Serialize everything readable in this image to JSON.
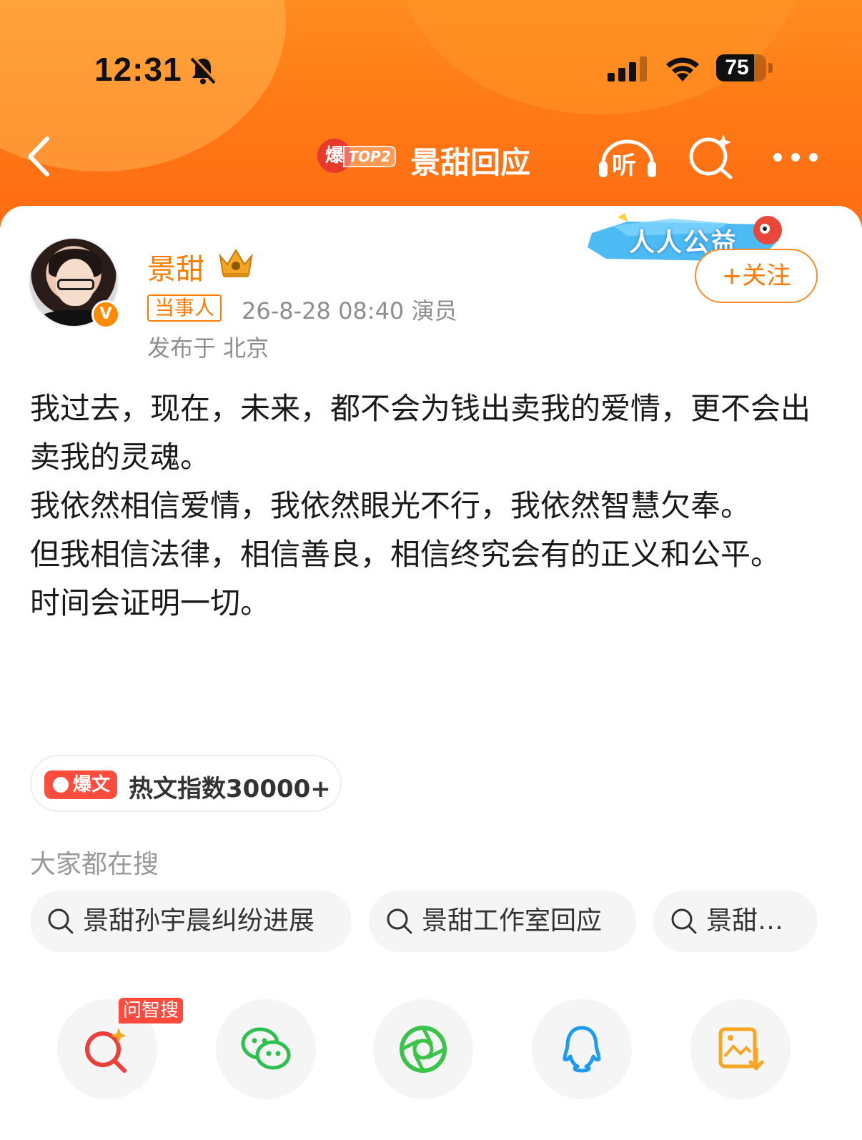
{
  "status_bar": {
    "time": "12:31",
    "battery": "75",
    "battery_level": 0.75
  },
  "nav": {
    "hot_badge_char": "爆",
    "rank": "TOP2",
    "title": "景甜回应",
    "listen_label": "听"
  },
  "post": {
    "author": "景甜",
    "role_tag": "当事人",
    "meta": "26-8-28 08:40  演员",
    "location": "发布于 北京",
    "follow_label": "+关注",
    "charity_banner": "人人公益",
    "verified_mark": "V",
    "body": [
      "我过去，现在，未来，都不会为钱出卖我的爱情，更不会出卖我的灵魂。",
      "我依然相信爱情，我依然眼光不行，我依然智慧欠奉。",
      "但我相信法律，相信善良，相信终究会有的正义和公平。",
      "时间会证明一切。"
    ]
  },
  "hot_index": {
    "tag": "爆文",
    "label": "热文指数30000+"
  },
  "search": {
    "heading": "大家都在搜",
    "chips": [
      "景甜孙宇晨纠纷进展",
      "景甜工作室回应",
      "景甜…"
    ]
  },
  "share": {
    "ai_badge": "问智搜",
    "items": [
      "ai-search-icon",
      "wechat-icon",
      "moments-icon",
      "qq-icon",
      "save-image-icon"
    ]
  },
  "colors": {
    "accent": "#ff7a00",
    "header": "#ff7a16",
    "hot_red": "#ff4d3d"
  }
}
